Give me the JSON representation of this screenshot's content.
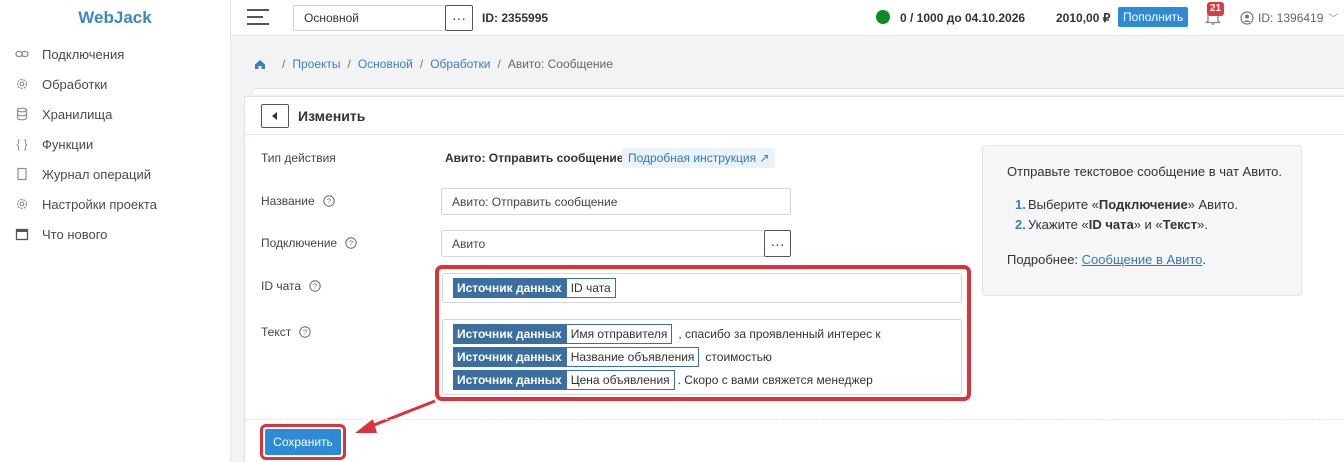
{
  "sidebar": {
    "logo": "WebJack",
    "items": [
      {
        "label": "Подключения",
        "icon": "link-icon"
      },
      {
        "label": "Обработки",
        "icon": "cog-icon"
      },
      {
        "label": "Хранилища",
        "icon": "database-icon"
      },
      {
        "label": "Функции",
        "icon": "braces-icon"
      },
      {
        "label": "Журнал операций",
        "icon": "document-icon"
      },
      {
        "label": "Настройки проекта",
        "icon": "cog-icon"
      },
      {
        "label": "Что нового",
        "icon": "calendar-icon"
      }
    ]
  },
  "topbar": {
    "project": "Основной",
    "project_id": "ID: 2355995",
    "quota": "0 / 1000 до 04.10.2026",
    "balance": "2010,00 ₽",
    "topup_label": "Пополнить",
    "notifications": "21",
    "user_id": "ID: 1396419",
    "status_color": "#0d8a27"
  },
  "breadcrumb": {
    "items": [
      "Проекты",
      "Основной",
      "Обработки"
    ],
    "current": "Авито: Сообщение"
  },
  "form": {
    "title": "Изменить",
    "type_label": "Тип действия",
    "type_value": "Авито: Отправить сообщение",
    "instruction_link": "Подробная инструкция ↗",
    "name_label": "Название",
    "name_value": "Авито: Отправить сообщение",
    "connection_label": "Подключение",
    "connection_value": "Авито",
    "chat_id_label": "ID чата",
    "text_label": "Текст",
    "source_chip": "Источник данных",
    "chat_id_token": "ID чата",
    "text_lines": [
      {
        "token": "Имя отправителя",
        "text": ", спасибо за проявленный интерес к"
      },
      {
        "token": "Название объявления",
        "text": "стоимостью"
      },
      {
        "token": "Цена объявления",
        "text": ". Скоро с вами свяжется менеджер"
      }
    ],
    "save_label": "Сохранить",
    "highlight_color": "#d8343a"
  },
  "info": {
    "intro": "Отправьте текстовое сообщение в чат Авито.",
    "steps": [
      {
        "num": "1.",
        "pre": "Выберите «",
        "bold": "Подключение",
        "post": "» Авито."
      },
      {
        "num": "2.",
        "pre": "Укажите «",
        "bold": "ID чата",
        "mid": "» и «",
        "bold2": "Текст",
        "post": "»."
      }
    ],
    "more_prefix": "Подробнее: ",
    "more_link": "Сообщение в Авито",
    "more_suffix": "."
  }
}
